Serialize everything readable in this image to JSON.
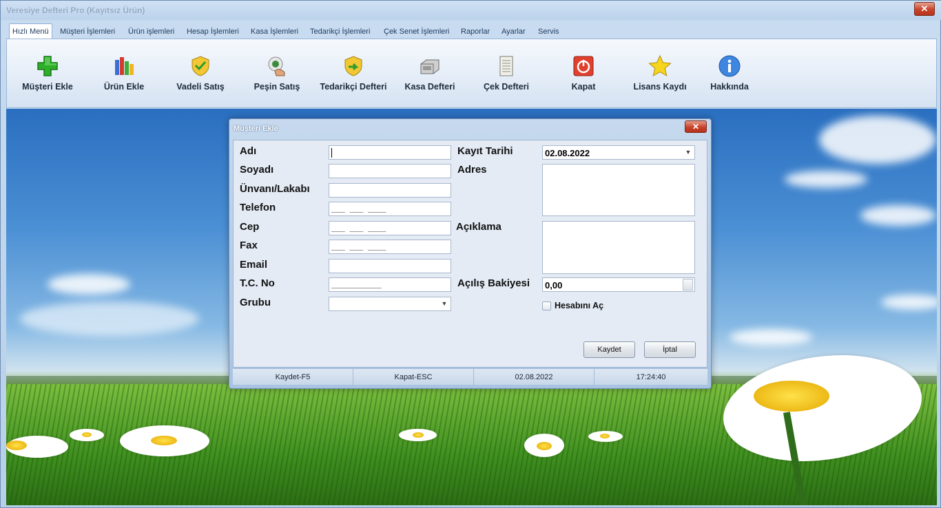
{
  "window": {
    "title": "Veresiye Defteri Pro (Kayıtsız Ürün)",
    "close": "✕"
  },
  "tabs": [
    {
      "label": "Hızlı Menü"
    },
    {
      "label": "Müşteri İşlemleri"
    },
    {
      "label": "Ürün işlemleri"
    },
    {
      "label": "Hesap İşlemleri"
    },
    {
      "label": "Kasa İşlemleri"
    },
    {
      "label": "Tedarikçi İşlemleri"
    },
    {
      "label": "Çek Senet İşlemleri"
    },
    {
      "label": "Raporlar"
    },
    {
      "label": "Ayarlar"
    },
    {
      "label": "Servis"
    }
  ],
  "ribbon": [
    {
      "label": "Müşteri Ekle",
      "icon": "plus-icon"
    },
    {
      "label": "Ürün Ekle",
      "icon": "products-icon"
    },
    {
      "label": "Vadeli Satış",
      "icon": "shield-check-icon"
    },
    {
      "label": "Peşin Satış",
      "icon": "hand-coin-icon"
    },
    {
      "label": "Tedarikçi Defteri",
      "icon": "shield-arrow-icon"
    },
    {
      "label": "Kasa Defteri",
      "icon": "cash-register-icon"
    },
    {
      "label": "Çek Defteri",
      "icon": "scroll-icon"
    },
    {
      "label": "Kapat",
      "icon": "power-icon"
    },
    {
      "label": "Lisans Kaydı",
      "icon": "star-icon"
    },
    {
      "label": "Hakkında",
      "icon": "info-icon"
    }
  ],
  "dialog": {
    "title": "Müşteri Ekle",
    "close": "✕",
    "labels": {
      "adi": "Adı",
      "soyadi": "Soyadı",
      "unvan": "Ünvanı/Lakabı",
      "telefon": "Telefon",
      "cep": "Cep",
      "fax": "Fax",
      "email": "Email",
      "tcno": "T.C. No",
      "grubu": "Grubu",
      "kayit_tarihi": "Kayıt Tarihi",
      "adres": "Adres",
      "aciklama": "Açıklama",
      "acilis_bakiyesi": "Açılış Bakiyesi",
      "hesabini_ac": "Hesabını Aç"
    },
    "values": {
      "adi": "",
      "soyadi": "",
      "unvan": "",
      "telefon_mask": "___ ___ ____",
      "cep_mask": "___ ___ ____",
      "fax_mask": "___ ___ ____",
      "email": "",
      "tcno_mask": "___________",
      "grubu": "",
      "kayit_tarihi": "02.08.2022",
      "acilis_bakiyesi": "0,00",
      "hesabini_ac_checked": false
    },
    "buttons": {
      "kaydet": "Kaydet",
      "iptal": "İptal"
    },
    "status": [
      "Kaydet-F5",
      "Kapat-ESC",
      "02.08.2022",
      "17:24:40"
    ]
  }
}
